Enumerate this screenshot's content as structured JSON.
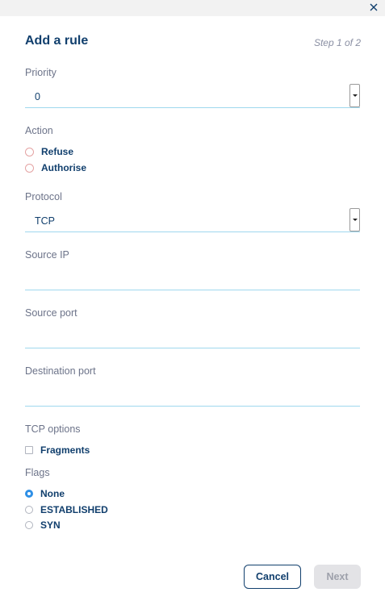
{
  "header": {
    "title": "Add a rule",
    "step": "Step 1 of 2"
  },
  "priority": {
    "label": "Priority",
    "value": "0"
  },
  "action": {
    "label": "Action",
    "options": [
      "Refuse",
      "Authorise"
    ],
    "selected": null
  },
  "protocol": {
    "label": "Protocol",
    "value": "TCP"
  },
  "source_ip": {
    "label": "Source IP",
    "value": ""
  },
  "source_port": {
    "label": "Source port",
    "value": ""
  },
  "destination_port": {
    "label": "Destination port",
    "value": ""
  },
  "tcp_options": {
    "label": "TCP options",
    "fragments_label": "Fragments",
    "fragments_checked": false
  },
  "flags": {
    "label": "Flags",
    "options": [
      "None",
      "ESTABLISHED",
      "SYN"
    ],
    "selected": "None"
  },
  "buttons": {
    "cancel": "Cancel",
    "next": "Next"
  },
  "colors": {
    "title": "#113f6d",
    "accent_line": "#9fd8ee",
    "radio_selected": "#2e8fe6",
    "radio_required": "#e4a3a3",
    "disabled_button": "#e3e3e6"
  },
  "icons": {
    "close": "close-icon",
    "dropdown": "caret-down-icon"
  }
}
